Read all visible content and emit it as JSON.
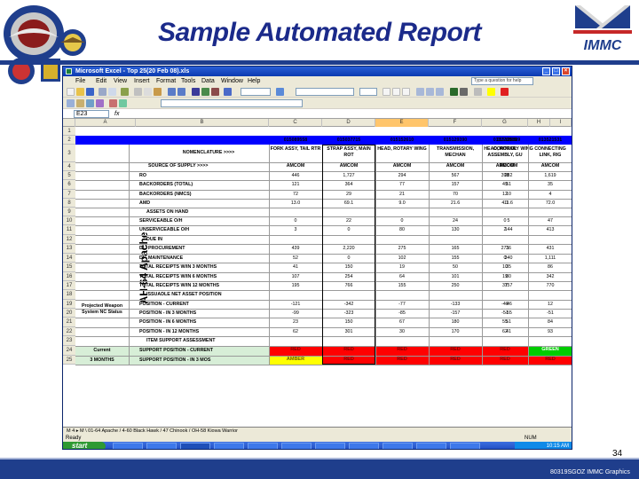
{
  "slide": {
    "title": "Sample Automated Report",
    "page_number": "34",
    "footer": "80319SGOZ IMMC Graphics",
    "logo_right_text": "IMMC"
  },
  "excel": {
    "window_title": "Microsoft Excel - Top 25(20 Feb 08).xls",
    "menu": [
      "File",
      "Edit",
      "View",
      "Insert",
      "Format",
      "Tools",
      "Data",
      "Window",
      "Help"
    ],
    "help_placeholder": "Type a question for help",
    "name_box": "E23",
    "columns": [
      "A",
      "B",
      "C",
      "D",
      "E",
      "F",
      "G",
      "H",
      "I"
    ],
    "selected_column": "E",
    "rows": [
      "1",
      "2",
      "3",
      "4",
      "5",
      "6",
      "7",
      "8",
      "9",
      "10",
      "11",
      "12",
      "13",
      "14",
      "15",
      "16",
      "17",
      "18",
      "19",
      "20",
      "21",
      "22",
      "23",
      "24",
      "25"
    ],
    "side_label": "AH-64 Apache",
    "projected_label": "Projected Weapon System NC Status",
    "part_numbers": [
      "015089558",
      "015037715",
      "015152610",
      "015129390",
      "015129889",
      "013770815",
      "013521531"
    ],
    "nomenclature_label": "NOMENCLATURE >>>>",
    "nomenclature": [
      "FORK ASSY, TAIL RTR",
      "STRAP ASSY, MAIN ROT",
      "HEAD, ROTARY WING",
      "TRANSMISSION, MECHAN",
      "HEAD, ROTARY WING",
      "CONTROL ASSEMBLY, GU",
      "CONNECTING LINK, RIG"
    ],
    "source_label": "SOURCE OF SUPPLY >>>>",
    "source": [
      "AMCOM",
      "AMCOM",
      "AMCOM",
      "AMCOM",
      "AMCOM",
      "AMCOM",
      "AMCOM"
    ],
    "data_rows": [
      {
        "label": "RO",
        "values": [
          "446",
          "1,727",
          "294",
          "567",
          "282",
          "398",
          "1,619"
        ]
      },
      {
        "label": "BACKORDERS (TOTAL)",
        "values": [
          "121",
          "364",
          "77",
          "157",
          "51",
          "49",
          "35"
        ]
      },
      {
        "label": "BACKORDERS (NMCS)",
        "values": [
          "72",
          "29",
          "21",
          "70",
          "10",
          "12",
          "4"
        ]
      },
      {
        "label": "AMD",
        "values": [
          "13.0",
          "69.1",
          "9.0",
          "21.6",
          "11.6",
          "4.1",
          "72.0"
        ]
      },
      {
        "label": "ASSETS ON HAND",
        "values": [
          "",
          "",
          "",
          "",
          "",
          "",
          ""
        ]
      },
      {
        "label": "SERVICEABLE O/H",
        "values": [
          "0",
          "22",
          "0",
          "24",
          "5",
          "0",
          "47"
        ]
      },
      {
        "label": "UNSERVICEABLE O/H",
        "values": [
          "3",
          "0",
          "80",
          "130",
          "144",
          "2",
          "413"
        ]
      },
      {
        "label": "DUE IN",
        "values": [
          "",
          "",
          "",
          "",
          "",
          "",
          ""
        ]
      },
      {
        "label": "DI - PROCUREMENT",
        "values": [
          "439",
          "2,220",
          "275",
          "165",
          "36",
          "271",
          "431"
        ]
      },
      {
        "label": "DI - MAINTENANCE",
        "values": [
          "52",
          "0",
          "102",
          "155",
          "340",
          "0",
          "1,111"
        ]
      },
      {
        "label": "TOTAL RECEIPTS W/IN 3 MONTHS",
        "values": [
          "41",
          "150",
          "19",
          "50",
          "35",
          "10",
          "86"
        ]
      },
      {
        "label": "TOTAL RECEIPTS W/IN 6 MONTHS",
        "values": [
          "107",
          "254",
          "64",
          "101",
          "80",
          "19",
          "342"
        ]
      },
      {
        "label": "TOTAL RECEIPTS W/IN 12 MONTHS",
        "values": [
          "195",
          "766",
          "155",
          "250",
          "157",
          "37",
          "770"
        ]
      },
      {
        "label": "ISSUADLE NET ASSET POSITION",
        "values": [
          "",
          "",
          "",
          "",
          "",
          "",
          ""
        ]
      },
      {
        "label": "POSITION - CURRENT",
        "values": [
          "-121",
          "-342",
          "-77",
          "-133",
          "-46",
          "-49",
          "12"
        ]
      },
      {
        "label": "POSITION - IN 3 MONTHS",
        "values": [
          "-99",
          "-323",
          "-85",
          "-157",
          "-55",
          "-51",
          "-51"
        ]
      },
      {
        "label": "POSITION - IN 6 MONTHS",
        "values": [
          "23",
          "150",
          "67",
          "180",
          "51",
          "55",
          "84"
        ]
      },
      {
        "label": "POSITION - IN 12 MONTHS",
        "values": [
          "62",
          "301",
          "30",
          "170",
          "41",
          "62",
          "93"
        ]
      },
      {
        "label": "ITEM SUPPORT ASSESSMENT",
        "values": [
          "",
          "",
          "",
          "",
          "",
          "",
          ""
        ]
      }
    ],
    "status_rows": [
      {
        "period": "Current",
        "label": "SUPPORT POSITION - CURRENT",
        "statuses": [
          "RED",
          "RED",
          "RED",
          "RED",
          "RED",
          "RED",
          "GREEN"
        ]
      },
      {
        "period": "3 MONTHS",
        "label": "SUPPORT POSITION - IN 3 MOS",
        "statuses": [
          "AMBER",
          "RED",
          "RED",
          "RED",
          "RED",
          "RED",
          "RED"
        ]
      }
    ],
    "status_colors": {
      "RED": "#ff0000",
      "AMBER": "#ffff00",
      "GREEN": "#00cc00"
    },
    "sheet_tabs": "M 4 ▸ M \\ 01-64 Apache / 4-60 Black Hawk / 47 Chinook / OH-58 Kiowa Warrior",
    "status_bar": "Ready",
    "status_bar_right": "NUM",
    "taskbar": {
      "start": "start",
      "clock": "10:15 AM"
    }
  }
}
